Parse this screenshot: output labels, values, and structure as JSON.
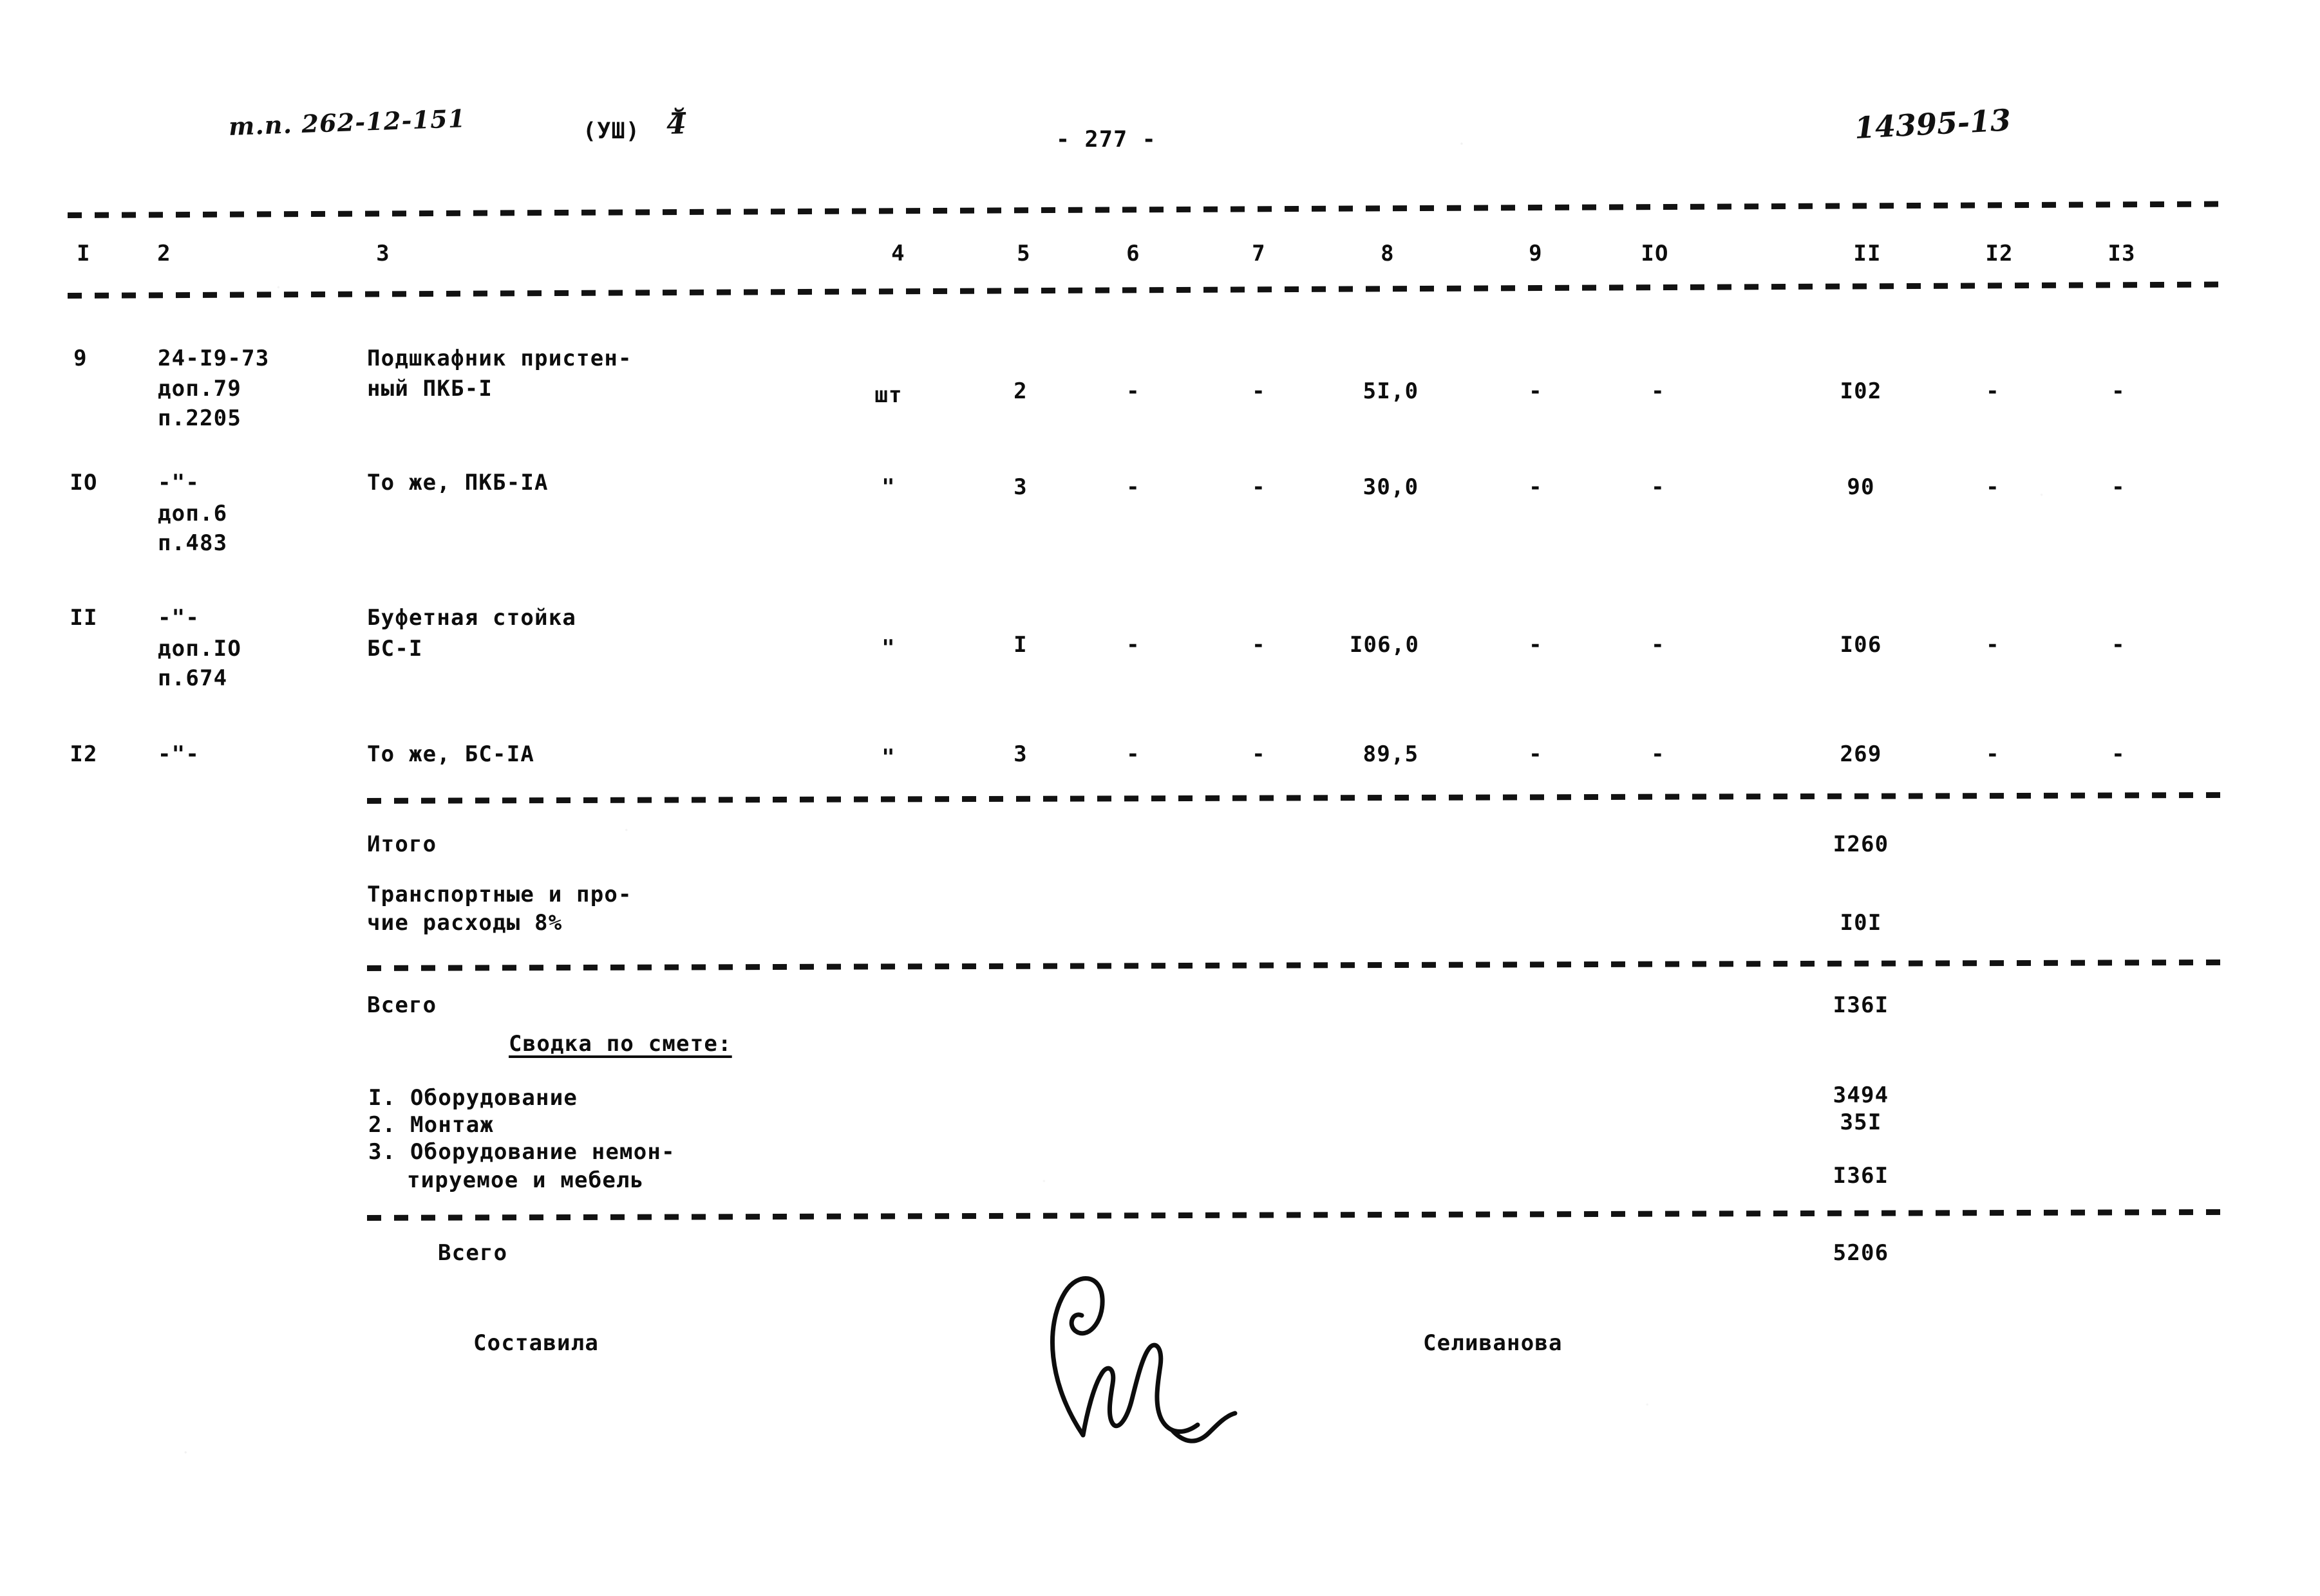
{
  "header": {
    "doc_code": "т.п. 262-12-151",
    "series_mark": "(УШ)",
    "hand_mark": "4̅̆",
    "page_number": "- 277 -",
    "archive_number": "14395-13"
  },
  "table": {
    "column_headers": [
      "I",
      "2",
      "3",
      "4",
      "5",
      "6",
      "7",
      "8",
      "9",
      "IO",
      "II",
      "I2",
      "I3"
    ],
    "rows": [
      {
        "num": "9",
        "code_lines": [
          "24-I9-73",
          "доп.79",
          "п.2205"
        ],
        "desc_lines": [
          "Подшкафник пристен-",
          "ный ПКБ-I"
        ],
        "unit": "шт",
        "qty": "2",
        "c6": "-",
        "c7": "-",
        "c8": "5I,0",
        "c9": "-",
        "c10": "-",
        "c11": "I02",
        "c12": "-",
        "c13": "-"
      },
      {
        "num": "IO",
        "code_lines": [
          "-\"-",
          "доп.6",
          "п.483"
        ],
        "desc_lines": [
          "То же, ПКБ-IA"
        ],
        "unit": "\"",
        "qty": "3",
        "c6": "-",
        "c7": "-",
        "c8": "30,0",
        "c9": "-",
        "c10": "-",
        "c11": "90",
        "c12": "-",
        "c13": "-"
      },
      {
        "num": "II",
        "code_lines": [
          "-\"-",
          "доп.IO",
          "п.674"
        ],
        "desc_lines": [
          "Буфетная стойка",
          "БС-I"
        ],
        "unit": "\"",
        "qty": "I",
        "c6": "-",
        "c7": "-",
        "c8": "I06,0",
        "c9": "-",
        "c10": "-",
        "c11": "I06",
        "c12": "-",
        "c13": "-"
      },
      {
        "num": "I2",
        "code_lines": [
          "-\"-"
        ],
        "desc_lines": [
          "То же, БС-IA"
        ],
        "unit": "\"",
        "qty": "3",
        "c6": "-",
        "c7": "-",
        "c8": "89,5",
        "c9": "-",
        "c10": "-",
        "c11": "269",
        "c12": "-",
        "c13": "-"
      }
    ]
  },
  "totals": {
    "itogo_label": "Итого",
    "itogo_value": "I260",
    "transport_label_line1": "Транспортные и про-",
    "transport_label_line2": "чие расходы 8%",
    "transport_value": "I0I",
    "vsego_label": "Всего",
    "vsego_value": "I36I"
  },
  "summary": {
    "title": "Сводка по смете:",
    "items": [
      {
        "label_line1": "I. Оборудование",
        "label_line2": "",
        "value": "3494"
      },
      {
        "label_line1": "2. Монтаж",
        "label_line2": "",
        "value": "35I"
      },
      {
        "label_line1": "3. Оборудование немон-",
        "label_line2": "тируемое и мебель",
        "value": "I36I"
      }
    ],
    "grand_total_label": "Всего",
    "grand_total_value": "5206"
  },
  "signature": {
    "role_label": "Составила",
    "name": "Селиванова"
  }
}
